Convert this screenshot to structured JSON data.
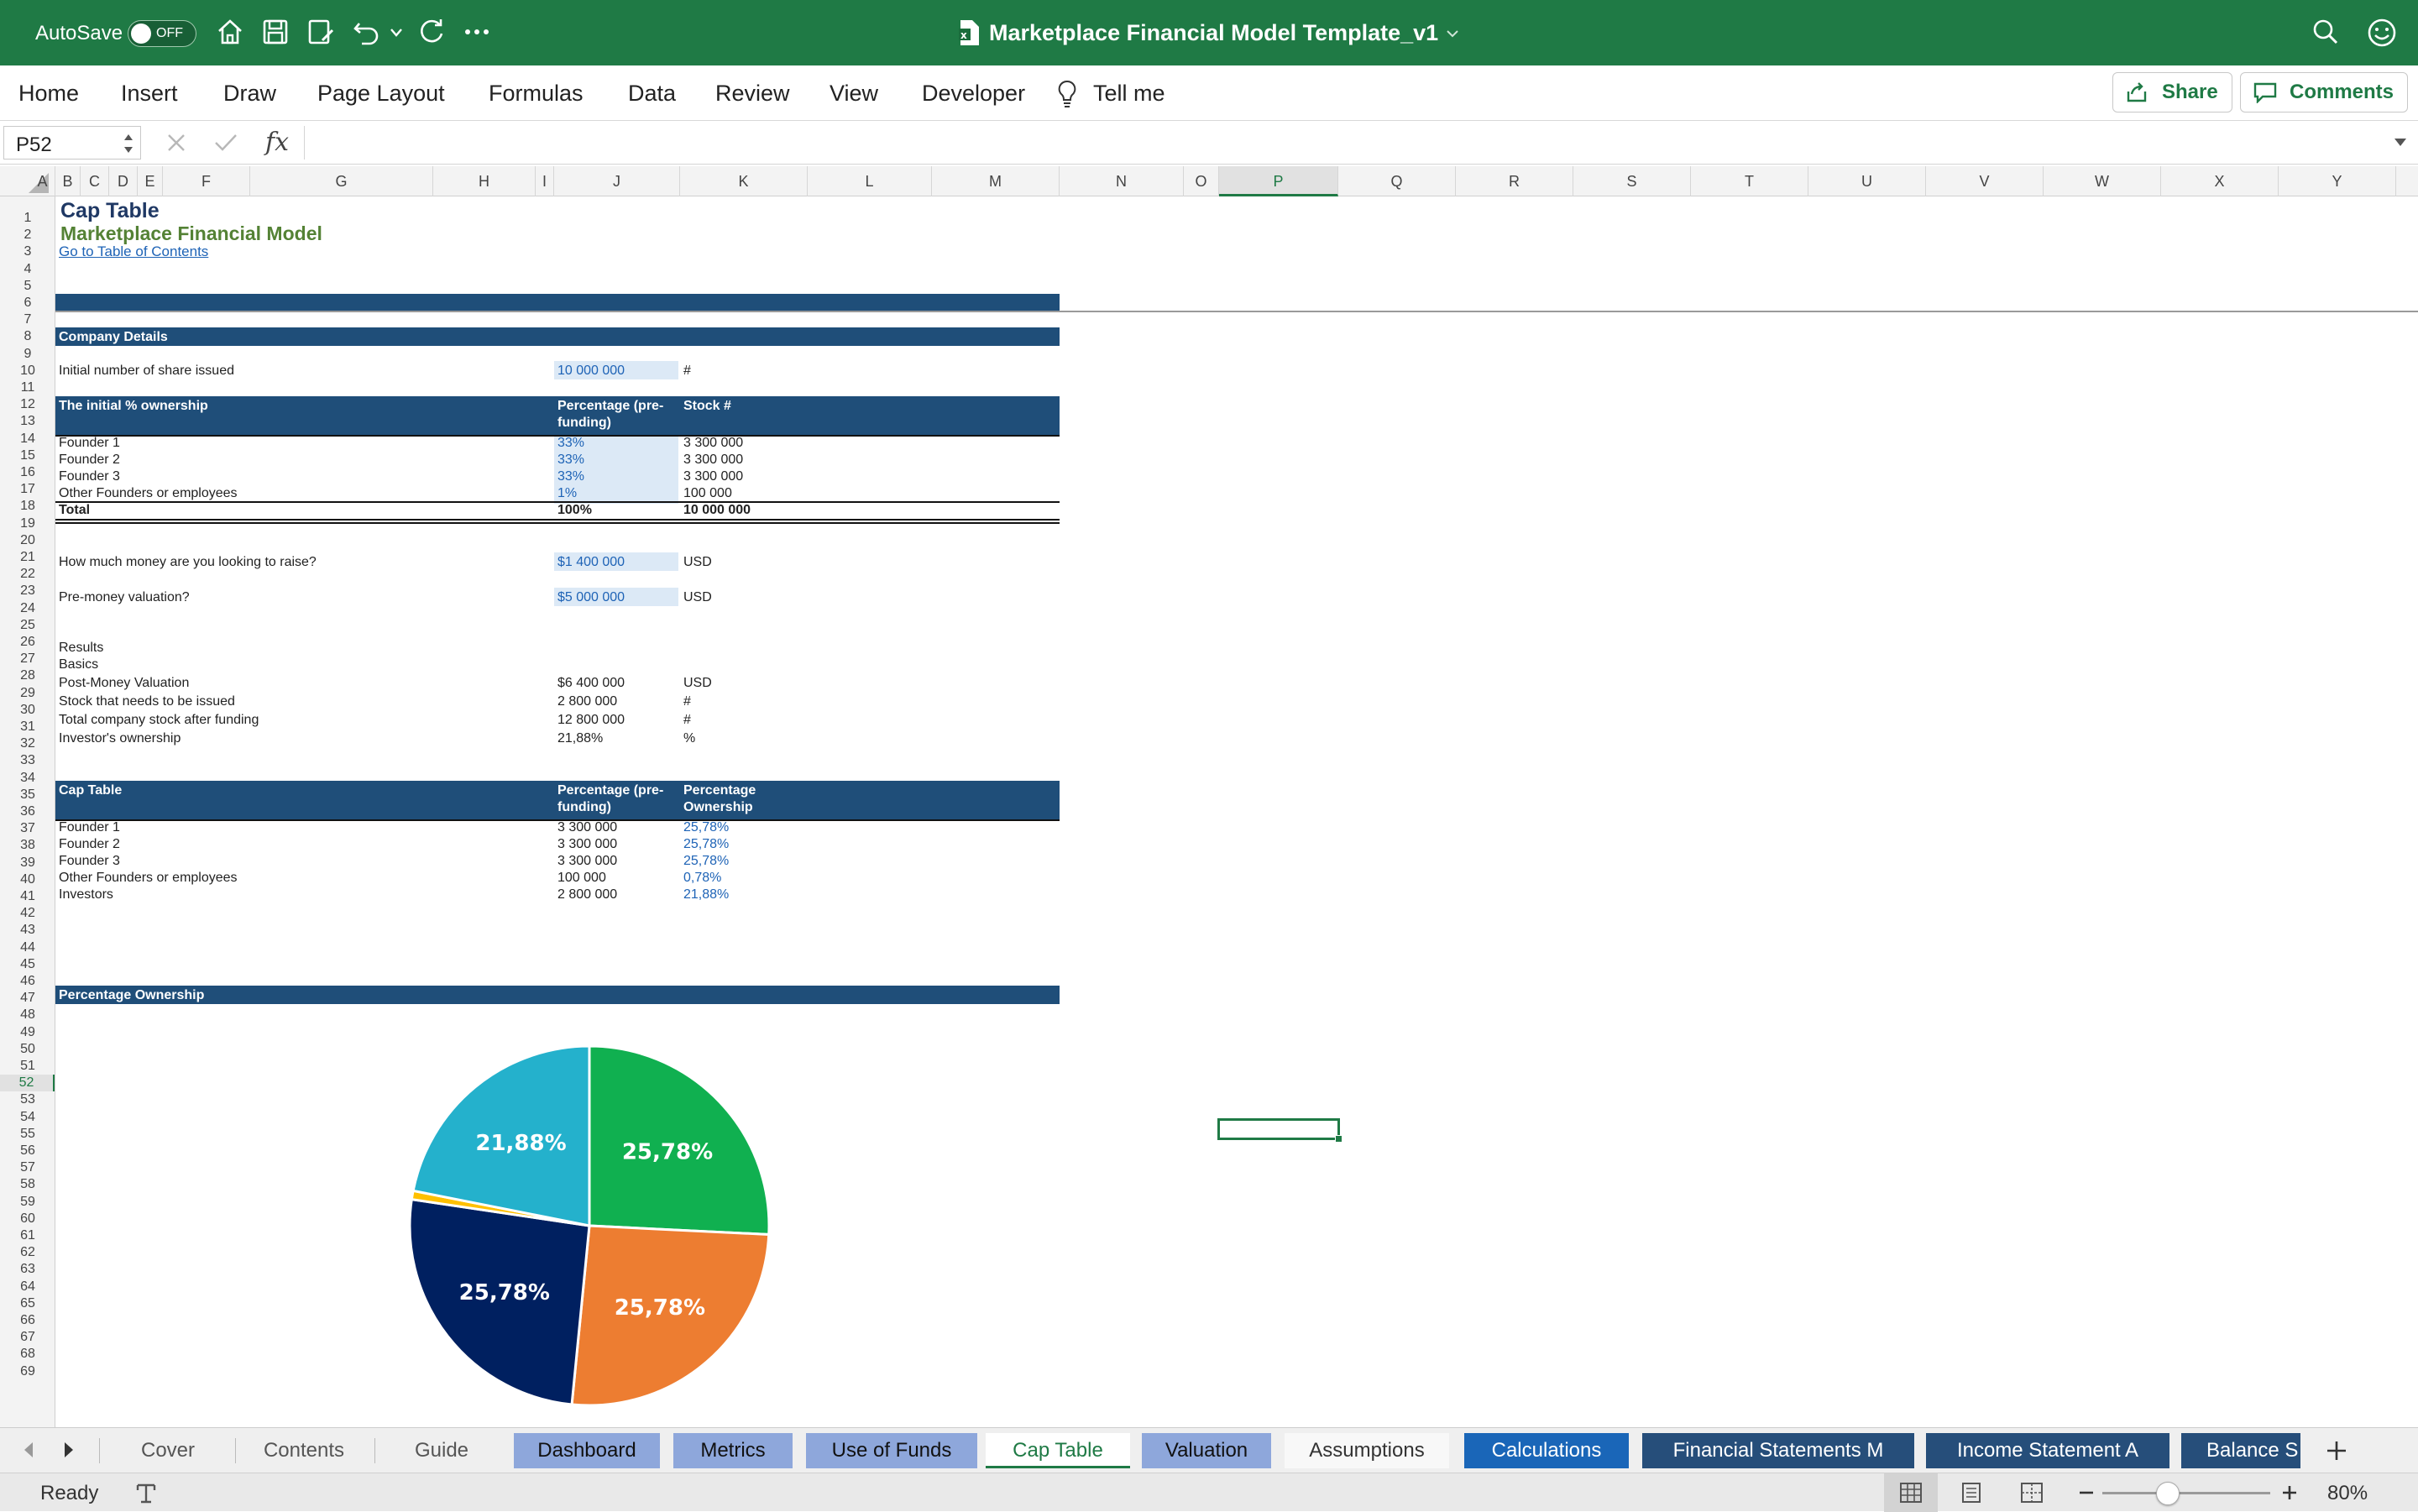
{
  "titlebar": {
    "autosave_label": "AutoSave",
    "autosave_state": "OFF",
    "document_title": "Marketplace Financial Model Template_v1"
  },
  "menu": {
    "items": [
      "Home",
      "Insert",
      "Draw",
      "Page Layout",
      "Formulas",
      "Data",
      "Review",
      "View",
      "Developer",
      "Tell me"
    ],
    "share_label": "Share",
    "comments_label": "Comments"
  },
  "formula_bar": {
    "name_box": "P52",
    "fx_label": "fx",
    "formula": ""
  },
  "columns": [
    "A",
    "B",
    "C",
    "D",
    "E",
    "F",
    "G",
    "H",
    "I",
    "J",
    "K",
    "L",
    "M",
    "N",
    "O",
    "P",
    "Q",
    "R",
    "S",
    "T",
    "U",
    "V",
    "W",
    "X",
    "Y"
  ],
  "active_column": "P",
  "active_row": 52,
  "sheet": {
    "title": "Cap Table",
    "subtitle": "Marketplace Financial Model",
    "toc_link": "Go to Table of Contents",
    "company_details_header": "Company Details",
    "initial_shares_label": "Initial number of share issued",
    "initial_shares_value": "10 000 000",
    "initial_shares_unit": "#",
    "ownership_header": {
      "label": "The initial % ownership",
      "col1": "Percentage (pre-",
      "col1b": "funding)",
      "col2": "Stock #"
    },
    "ownership_rows": [
      {
        "name": "Founder 1",
        "pct": "33%",
        "stock": "3 300 000"
      },
      {
        "name": "Founder 2",
        "pct": "33%",
        "stock": "3 300 000"
      },
      {
        "name": "Founder 3",
        "pct": "33%",
        "stock": "3 300 000"
      },
      {
        "name": "Other Founders or employees",
        "pct": "1%",
        "stock": "100 000"
      }
    ],
    "ownership_total": {
      "name": "Total",
      "pct": "100%",
      "stock": "10 000 000"
    },
    "raise_label": "How much money are you looking to raise?",
    "raise_value": "$1 400 000",
    "raise_unit": "USD",
    "premoney_label": "Pre-money valuation?",
    "premoney_value": "$5 000 000",
    "premoney_unit": "USD",
    "results_label": "Results",
    "basics_label": "Basics",
    "results_rows": [
      {
        "label": "Post-Money Valuation",
        "value": "$6 400 000",
        "unit": "USD"
      },
      {
        "label": "Stock that needs to be issued",
        "value": "2 800 000",
        "unit": "#"
      },
      {
        "label": "Total company stock after funding",
        "value": "12 800 000",
        "unit": "#"
      },
      {
        "label": "Investor's ownership",
        "value": "21,88%",
        "unit": "%"
      }
    ],
    "captable_header": {
      "label": "Cap Table",
      "col1": "Percentage (pre-",
      "col1b": "funding)",
      "col2": "Percentage",
      "col2b": "Ownership"
    },
    "captable_rows": [
      {
        "name": "Founder 1",
        "stock": "3 300 000",
        "pct": "25,78%"
      },
      {
        "name": "Founder 2",
        "stock": "3 300 000",
        "pct": "25,78%"
      },
      {
        "name": "Founder 3",
        "stock": "3 300 000",
        "pct": "25,78%"
      },
      {
        "name": "Other Founders or employees",
        "stock": "100 000",
        "pct": "0,78%"
      },
      {
        "name": "Investors",
        "stock": "2 800 000",
        "pct": "21,88%"
      }
    ],
    "ownership_chart_header": "Percentage Ownership"
  },
  "chart_data": {
    "type": "pie",
    "categories": [
      "Founder 1",
      "Founder 2",
      "Founder 3",
      "Other Founders or employees",
      "Investors"
    ],
    "values": [
      25.78,
      25.78,
      25.78,
      0.78,
      21.88
    ],
    "data_labels": [
      "25,78%",
      "25,78%",
      "25,78%",
      "",
      "21,88%"
    ],
    "colors": [
      "#10b050",
      "#ed7d31",
      "#002060",
      "#ffc000",
      "#24b1cc"
    ]
  },
  "tabs": [
    {
      "label": "Cover",
      "style": "plain"
    },
    {
      "label": "Contents",
      "style": "plain"
    },
    {
      "label": "Guide",
      "style": "plain"
    },
    {
      "label": "Dashboard",
      "style": "lilac"
    },
    {
      "label": "Metrics",
      "style": "lilac"
    },
    {
      "label": "Use of Funds",
      "style": "lilac"
    },
    {
      "label": "Cap Table",
      "style": "active"
    },
    {
      "label": "Valuation",
      "style": "lilac"
    },
    {
      "label": "Assumptions",
      "style": "white"
    },
    {
      "label": "Calculations",
      "style": "blue"
    },
    {
      "label": "Financial Statements M",
      "style": "navy"
    },
    {
      "label": "Income Statement A",
      "style": "navy"
    },
    {
      "label": "Balance S",
      "style": "navy"
    }
  ],
  "status": {
    "ready": "Ready",
    "zoom": "80%",
    "zoom_level": 0.8
  }
}
